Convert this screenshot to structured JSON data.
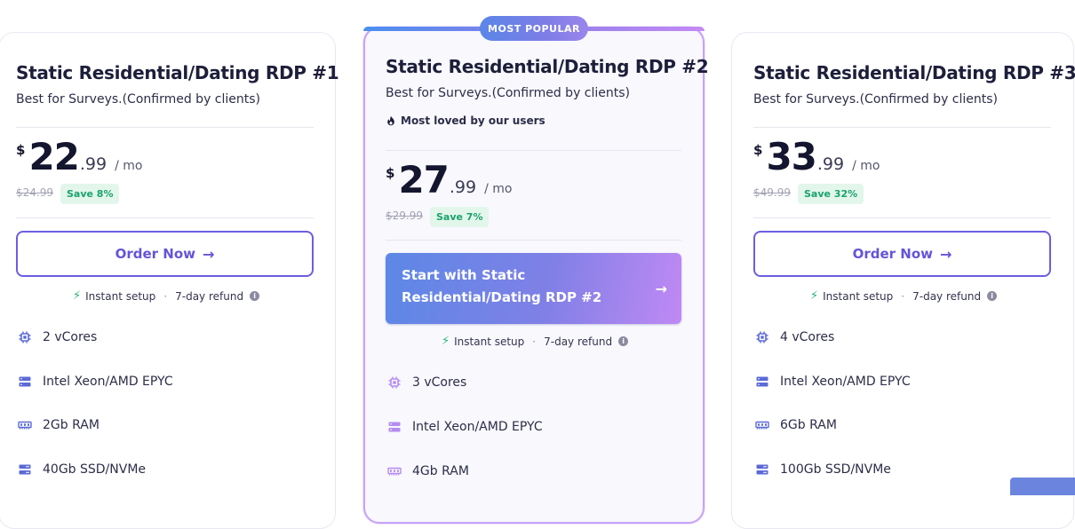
{
  "badge": "MOST POPULAR",
  "meta": {
    "instant": "Instant setup",
    "sep": "·",
    "refund": "7-day refund",
    "info": "i",
    "bolt": "⚡"
  },
  "order_label": "Order Now",
  "arrow": "→",
  "currency": "$",
  "per": "/ mo",
  "plans": [
    {
      "title": "Static Residential/Dating RDP #1",
      "subtitle": "Best for Surveys.(Confirmed by clients)",
      "price_int": "22",
      "price_dec": ".99",
      "old_price": "$24.99",
      "save": "Save 8%",
      "features": [
        "2 vCores",
        "Intel Xeon/AMD EPYC",
        "2Gb RAM",
        "40Gb SSD/NVMe"
      ]
    },
    {
      "title": "Static Residential/Dating RDP #2",
      "subtitle": "Best for Surveys.(Confirmed by clients)",
      "loved": "Most loved by our users",
      "price_int": "27",
      "price_dec": ".99",
      "old_price": "$29.99",
      "save": "Save 7%",
      "cta": "Start with Static Residential/Dating RDP #2",
      "features": [
        "3 vCores",
        "Intel Xeon/AMD EPYC",
        "4Gb RAM"
      ]
    },
    {
      "title": "Static Residential/Dating RDP #3",
      "subtitle": "Best for Surveys.(Confirmed by clients)",
      "price_int": "33",
      "price_dec": ".99",
      "old_price": "$49.99",
      "save": "Save 32%",
      "features": [
        "4 vCores",
        "Intel Xeon/AMD EPYC",
        "6Gb RAM",
        "100Gb SSD/NVMe"
      ]
    }
  ],
  "colors": {
    "accent": "#6354d9",
    "save_green": "#1aa36b",
    "icon_blue": "#5b6ad6",
    "icon_purple": "#b58cf0"
  }
}
